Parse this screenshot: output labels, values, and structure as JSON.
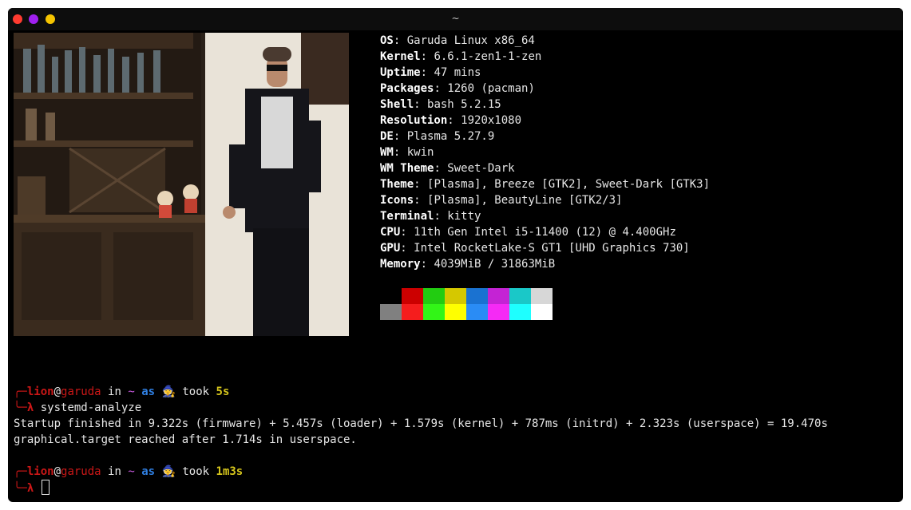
{
  "window": {
    "title": "~"
  },
  "sysinfo": [
    {
      "key": "OS",
      "value": "Garuda Linux x86_64"
    },
    {
      "key": "Kernel",
      "value": "6.6.1-zen1-1-zen"
    },
    {
      "key": "Uptime",
      "value": "47 mins"
    },
    {
      "key": "Packages",
      "value": "1260 (pacman)"
    },
    {
      "key": "Shell",
      "value": "bash 5.2.15"
    },
    {
      "key": "Resolution",
      "value": "1920x1080"
    },
    {
      "key": "DE",
      "value": "Plasma 5.27.9"
    },
    {
      "key": "WM",
      "value": "kwin"
    },
    {
      "key": "WM Theme",
      "value": "Sweet-Dark"
    },
    {
      "key": "Theme",
      "value": "[Plasma], Breeze [GTK2], Sweet-Dark [GTK3]"
    },
    {
      "key": "Icons",
      "value": "[Plasma], BeautyLine [GTK2/3]"
    },
    {
      "key": "Terminal",
      "value": "kitty"
    },
    {
      "key": "CPU",
      "value": "11th Gen Intel i5-11400 (12) @ 4.400GHz"
    },
    {
      "key": "GPU",
      "value": "Intel RocketLake-S GT1 [UHD Graphics 730]"
    },
    {
      "key": "Memory",
      "value": "4039MiB / 31863MiB"
    }
  ],
  "palette": {
    "normal": [
      "#000000",
      "#cc0000",
      "#22cc11",
      "#d5c800",
      "#1a72d1",
      "#c423d4",
      "#1ac8c8",
      "#d7d7d7"
    ],
    "bright": [
      "#808080",
      "#f51d1d",
      "#32f517",
      "#ffff00",
      "#2a8cf5",
      "#f52af5",
      "#1effff",
      "#ffffff"
    ]
  },
  "prompt1": {
    "user": "lion",
    "at": "@",
    "host": "garuda",
    "in": " in ",
    "dir": "~",
    "as": "as",
    "wizard": "🧙",
    "took": "took",
    "duration": "5s",
    "lambda": "λ",
    "command": "systemd-analyze"
  },
  "output": [
    "Startup finished in 9.322s (firmware) + 5.457s (loader) + 1.579s (kernel) + 787ms (initrd) + 2.323s (userspace) = 19.470s",
    "graphical.target reached after 1.714s in userspace."
  ],
  "prompt2": {
    "user": "lion",
    "at": "@",
    "host": "garuda",
    "in": " in ",
    "dir": "~",
    "as": "as",
    "wizard": "🧙",
    "took": "took",
    "duration": "1m3s",
    "lambda": "λ"
  }
}
